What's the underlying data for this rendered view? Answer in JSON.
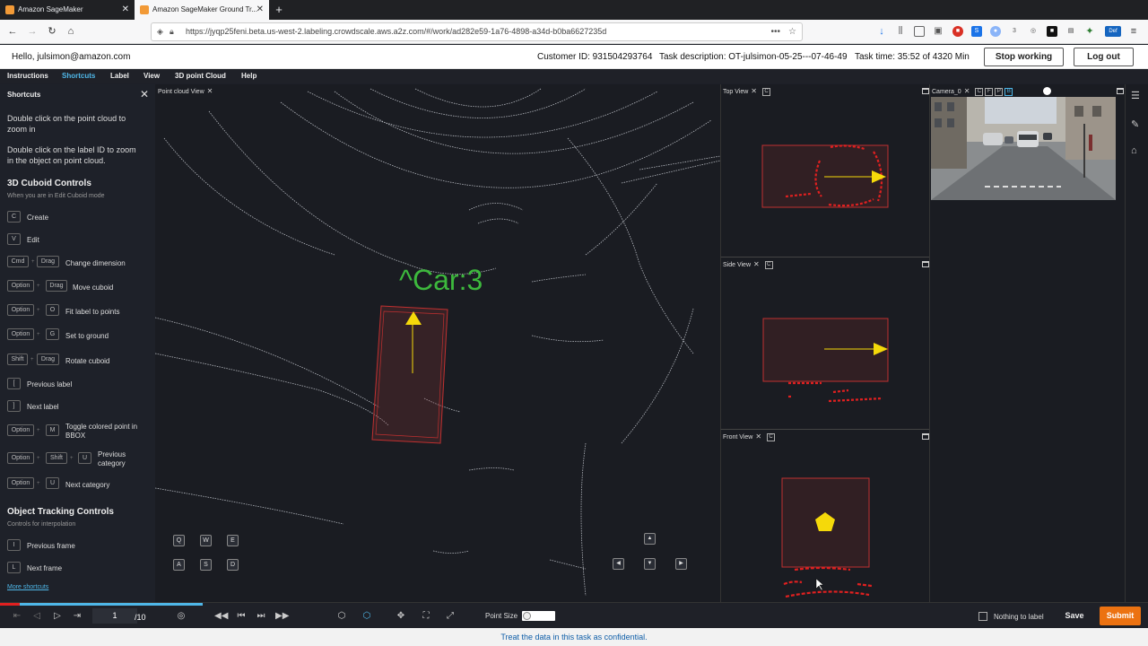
{
  "browser": {
    "tabs": [
      {
        "label": "Amazon SageMaker",
        "active": false
      },
      {
        "label": "Amazon SageMaker Ground Tr...",
        "active": true
      }
    ],
    "new_tab": "+",
    "url": "https://jyqp25feni.beta.us-west-2.labeling.crowdscale.aws.a2z.com/#/work/ad282e59-1a76-4898-a34d-b0ba6627235d"
  },
  "header": {
    "greeting": "Hello, julsimon@amazon.com",
    "customer_id": "Customer ID: 931504293764",
    "task_description": "Task description: OT-julsimon-05-25---07-46-49",
    "task_time": "Task time: 35:52 of 4320 Min",
    "stop_working": "Stop working",
    "log_out": "Log out"
  },
  "menubar": [
    "Instructions",
    "Shortcuts",
    "Label",
    "View",
    "3D point Cloud",
    "Help"
  ],
  "sidebar": {
    "title": "Shortcuts",
    "tip1": "Double click on the point cloud to zoom in",
    "tip1_a": "Double click on the point cloud to",
    "tip1_b": "zoom in",
    "tip2_a": "Double click on the label ID to zoom",
    "tip2_b": "in the object on point cloud.",
    "cuboid_title": "3D Cuboid Controls",
    "cuboid_sub": "When you are in Edit Cuboid mode",
    "shortcuts": [
      {
        "keys": [
          "C"
        ],
        "label": "Create"
      },
      {
        "keys": [
          "V"
        ],
        "label": "Edit"
      },
      {
        "keys": [
          "Cmd",
          "Drag"
        ],
        "label": "Change dimension"
      },
      {
        "keys": [
          "Option",
          "Drag"
        ],
        "label": "Move cuboid"
      },
      {
        "keys": [
          "Option",
          "O"
        ],
        "label": "Fit label to points"
      },
      {
        "keys": [
          "Option",
          "G"
        ],
        "label": "Set to ground"
      },
      {
        "keys": [
          "Shift",
          "Drag"
        ],
        "label": "Rotate cuboid"
      },
      {
        "keys": [
          "["
        ],
        "label": "Previous label"
      },
      {
        "keys": [
          "]"
        ],
        "label": "Next label"
      },
      {
        "keys": [
          "Option",
          "M"
        ],
        "label": "Toggle colored point in BBOX"
      },
      {
        "keys": [
          "Option",
          "Shift",
          "U"
        ],
        "label": "Previous category"
      },
      {
        "keys": [
          "Option",
          "U"
        ],
        "label": "Next category"
      }
    ],
    "labels": {
      "toggle_a": "Toggle colored point in",
      "toggle_b": "BBOX",
      "prevcat_a": "Previous",
      "prevcat_b": "category"
    },
    "tracking_title": "Object Tracking Controls",
    "tracking_sub": "Controls for interpolation",
    "tracking": [
      {
        "keys": [
          "I"
        ],
        "label": "Previous frame"
      },
      {
        "keys": [
          "L"
        ],
        "label": "Next frame"
      }
    ],
    "more": "More shortcuts"
  },
  "pointcloud": {
    "tab": "Point cloud View",
    "label": "^Car:3",
    "keys_top": [
      "Q",
      "W",
      "E"
    ],
    "keys_bottom": [
      "A",
      "S",
      "D"
    ]
  },
  "views": {
    "top": "Top View",
    "side": "Side View",
    "front": "Front View",
    "camera": "Camera_0",
    "c": "C",
    "camera_btns": [
      "C",
      "F",
      "P",
      "B"
    ]
  },
  "bottom": {
    "frame": "1",
    "total": "/10",
    "point_size": "Point Size",
    "nothing_to_label": "Nothing to label",
    "save": "Save",
    "submit": "Submit"
  },
  "footer": "Treat the data in this task as confidential.",
  "colors": {
    "accent_blue": "#4fb7e8",
    "label_green": "#3db83d",
    "box_red": "#e02020",
    "arrow_yellow": "#f5d90a",
    "submit_orange": "#ec7211"
  }
}
